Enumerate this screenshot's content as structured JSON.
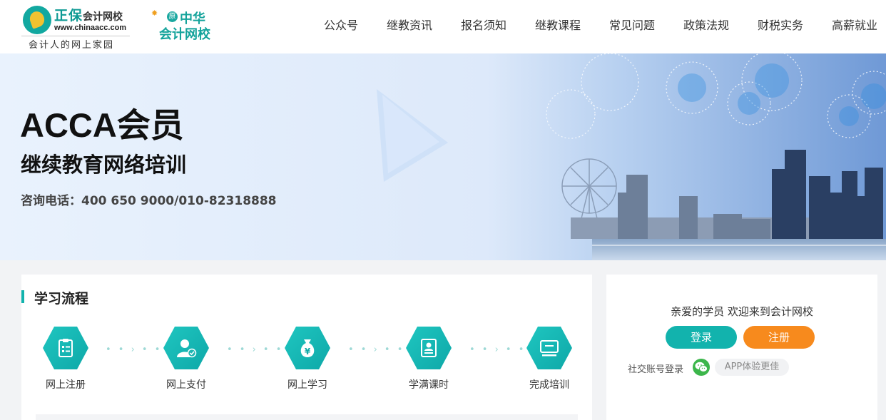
{
  "header": {
    "logo": {
      "brand": "正保",
      "brand_sub": "会计网校",
      "url": "www.chinaacc.com",
      "slogan": "会计人的网上家园"
    },
    "logo2": {
      "badge": "原",
      "top": "中华",
      "bottom": "会计网校"
    },
    "nav": [
      "公众号",
      "继教资讯",
      "报名须知",
      "继教课程",
      "常见问题",
      "政策法规",
      "财税实务",
      "高薪就业"
    ]
  },
  "banner": {
    "title": "ACCA会员",
    "subtitle": "继续教育网络培训",
    "phone": "咨询电话：400  650  9000/010-82318888"
  },
  "process": {
    "title": "学习流程",
    "steps": [
      {
        "label": "网上注册",
        "icon": "clipboard-icon"
      },
      {
        "label": "网上支付",
        "icon": "user-verified-icon"
      },
      {
        "label": "网上学习",
        "icon": "money-bag-icon"
      },
      {
        "label": "学满课时",
        "icon": "certificate-icon"
      },
      {
        "label": "完成培训",
        "icon": "monitor-icon"
      }
    ],
    "connector": "• • › • •"
  },
  "account": {
    "welcome": "亲爱的学员 欢迎来到会计网校",
    "login_label": "登录",
    "register_label": "注册",
    "social_label": "社交账号登录",
    "app_label": "APP体验更佳"
  },
  "colors": {
    "accent": "#12b3ad",
    "register": "#f78a1d",
    "wechat": "#3cb64b"
  }
}
